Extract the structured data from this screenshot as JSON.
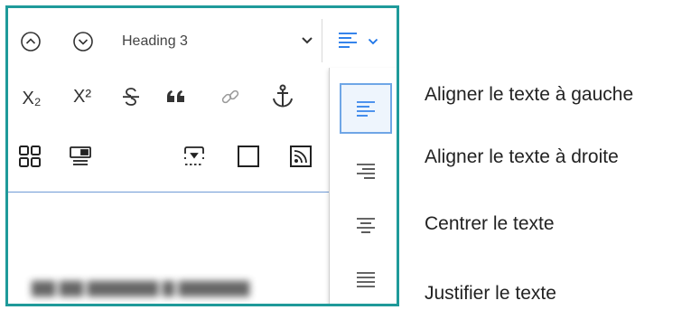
{
  "toolbar": {
    "heading_select": {
      "value": "Heading 3"
    },
    "row1_icons": [
      "circle-chevron-up-icon",
      "circle-chevron-down-icon"
    ],
    "row2_icons": [
      "subscript-icon",
      "superscript-icon",
      "strikethrough-icon",
      "quote-icon",
      "link-icon",
      "anchor-icon"
    ],
    "row3_icons": [
      "grid-icon",
      "template-icon",
      "dashed-frame-icon",
      "square-icon",
      "feed-icon"
    ],
    "subscript_text": "X₂",
    "superscript_text": "X²",
    "strike_text": "S",
    "quote_text": "❝"
  },
  "align_menu": {
    "accent_color": "#1a73e8",
    "selected": "left",
    "options": [
      "left",
      "right",
      "center",
      "justify"
    ]
  },
  "legend": {
    "left": "Aligner le texte à gauche",
    "right": "Aligner le texte à droite",
    "center": "Centrer le texte",
    "justify": "Justifier le texte"
  },
  "colors": {
    "frame": "#1f9a9a",
    "active_border": "#6fa6e6"
  }
}
